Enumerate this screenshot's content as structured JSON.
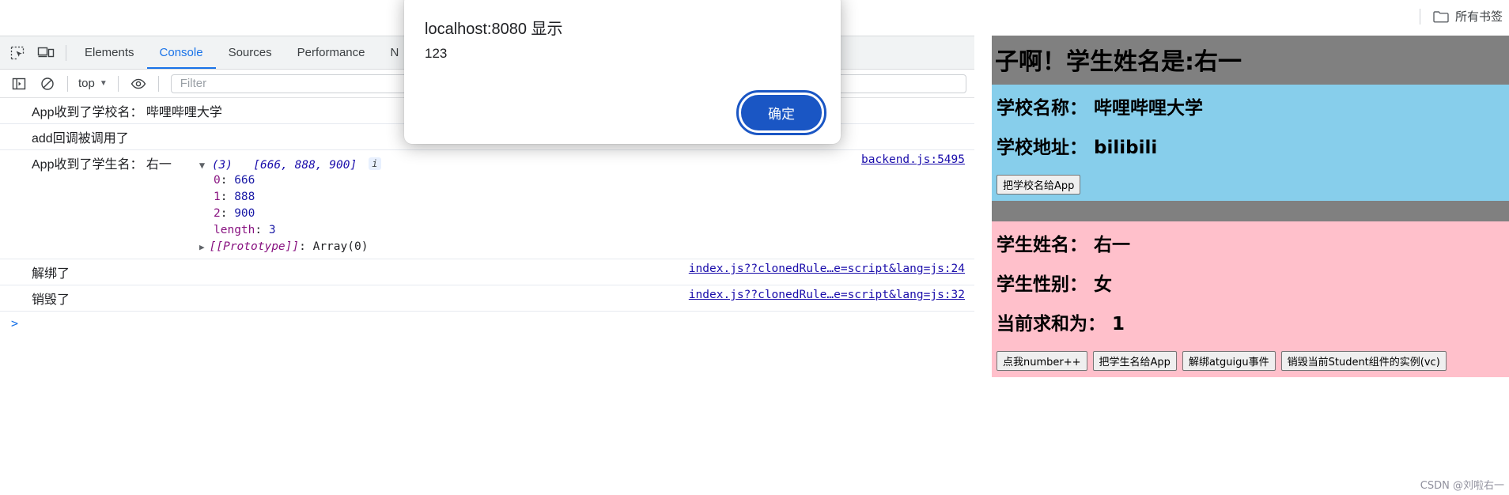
{
  "browser": {
    "bookmarks_label": "所有书签",
    "folder_icon": "folder-icon"
  },
  "devtools": {
    "inspect_icon": "inspect-element-icon",
    "device_icon": "device-toolbar-icon",
    "tabs": [
      {
        "label": "Elements",
        "active": false
      },
      {
        "label": "Console",
        "active": true
      },
      {
        "label": "Sources",
        "active": false
      },
      {
        "label": "Performance",
        "active": false
      },
      {
        "label": "N",
        "active": false
      }
    ],
    "toolbar": {
      "sidebar_icon": "console-sidebar-icon",
      "clear_icon": "clear-console-icon",
      "context": "top",
      "caret": "▼",
      "eye_icon": "live-expression-eye-icon",
      "filter_placeholder": "Filter",
      "filter_value": ""
    },
    "console_rows": [
      {
        "type": "simple",
        "text": "App收到了学校名： 哔哩哔哩大学",
        "source": ""
      },
      {
        "type": "simple",
        "text": "add回调被调用了",
        "source": ""
      },
      {
        "type": "array",
        "label": "App收到了学生名： 右一",
        "toggle": "▼",
        "count": "(3)",
        "preview": "[666, 888, 900]",
        "info_badge": "i",
        "entries": [
          {
            "key": "0",
            "value": "666"
          },
          {
            "key": "1",
            "value": "888"
          },
          {
            "key": "2",
            "value": "900"
          },
          {
            "key": "length",
            "value": "3"
          }
        ],
        "proto_toggle": "▶",
        "proto_key": "[[Prototype]]",
        "proto_value": "Array(0)",
        "source": "backend.js:5495"
      },
      {
        "type": "simple",
        "text": "解绑了",
        "source": "index.js??clonedRule…e=script&lang=js:24"
      },
      {
        "type": "simple",
        "text": "销毁了",
        "source": "index.js??clonedRule…e=script&lang=js:32"
      }
    ],
    "prompt_caret": ">"
  },
  "alert": {
    "origin": "localhost:8080 显示",
    "message": "123",
    "ok_label": "确定"
  },
  "page": {
    "header_title": "子啊！学生姓名是:右一",
    "school": {
      "name_line": "学校名称： 哔哩哔哩大学",
      "address_line": "学校地址： bilibili",
      "button": "把学校名给App"
    },
    "student": {
      "name_line": "学生姓名： 右一",
      "gender_line": "学生性别： 女",
      "sum_line": "当前求和为： 1",
      "buttons": [
        "点我number++",
        "把学生名给App",
        "解绑atguigu事件",
        "销毁当前Student组件的实例(vc)"
      ]
    },
    "watermark": "CSDN @刘啦右一"
  },
  "colors": {
    "accent_blue": "#1a73e8",
    "dialog_blue": "#1a56c4",
    "band_gray": "#808080",
    "band_blue": "#87ceeb",
    "band_pink": "#ffc0cb",
    "link": "#1a0dab"
  }
}
